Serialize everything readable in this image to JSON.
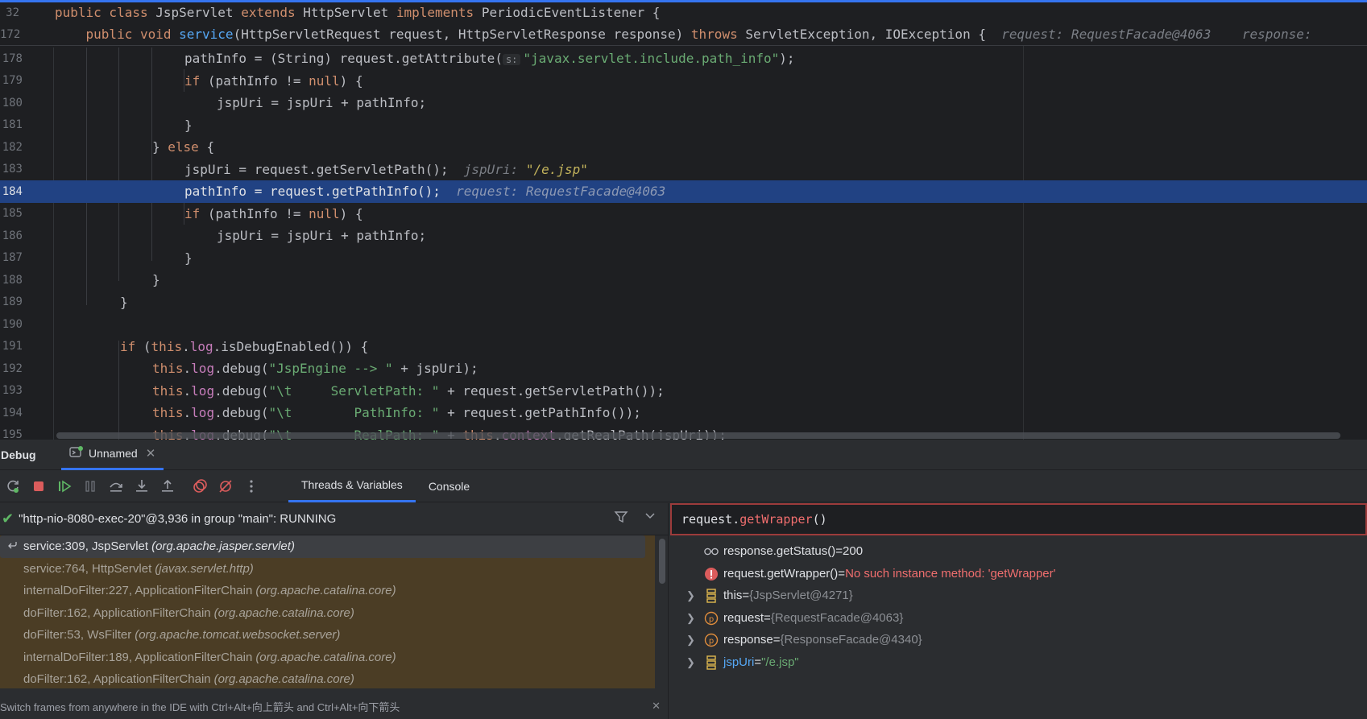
{
  "editor": {
    "sticky_lines": [
      {
        "num": "32",
        "code": "public class JspServlet extends HttpServlet implements PeriodicEventListener {"
      },
      {
        "num": "172",
        "code": "    public void service(HttpServletRequest request, HttpServletResponse response) throws ServletException, IOException {",
        "inlay": "request: RequestFacade@4063    response:"
      }
    ],
    "lines": [
      {
        "num": "178",
        "code": "pathInfo = (String) request.getAttribute(",
        "hint": "s:",
        "code2": "\"javax.servlet.include.path_info\");"
      },
      {
        "num": "179",
        "code": "if (pathInfo != null) {"
      },
      {
        "num": "180",
        "code": "jspUri = jspUri + pathInfo;"
      },
      {
        "num": "181",
        "code": "}"
      },
      {
        "num": "182",
        "code": "} else {"
      },
      {
        "num": "183",
        "code": "jspUri = request.getServletPath();",
        "inlay_label": "jspUri:",
        "inlay_value": "\"/e.jsp\""
      },
      {
        "num": "184",
        "code": "pathInfo = request.getPathInfo();",
        "inlay_label": "request: RequestFacade@4063"
      },
      {
        "num": "185",
        "code": "if (pathInfo != null) {"
      },
      {
        "num": "186",
        "code": "jspUri = jspUri + pathInfo;"
      },
      {
        "num": "187",
        "code": "}"
      },
      {
        "num": "188",
        "code": "}"
      },
      {
        "num": "189",
        "code": "}"
      },
      {
        "num": "190",
        "code": ""
      },
      {
        "num": "191",
        "code": "if (this.log.isDebugEnabled()) {"
      },
      {
        "num": "192",
        "code": "this.log.debug(\"JspEngine --> \" + jspUri);"
      },
      {
        "num": "193",
        "code": "this.log.debug(\"\\t     ServletPath: \" + request.getServletPath());"
      },
      {
        "num": "194",
        "code": "this.log.debug(\"\\t        PathInfo: \" + request.getPathInfo());"
      },
      {
        "num": "195",
        "code": "this.log.debug(\"\\t        RealPath: \" + this.context.getRealPath(jspUri));"
      }
    ]
  },
  "debug": {
    "title": "Debug",
    "session_tab": "Unnamed",
    "tabs": [
      "Threads & Variables",
      "Console"
    ],
    "thread": "\"http-nio-8080-exec-20\"@3,936 in group \"main\": RUNNING",
    "frames": [
      {
        "method": "service:309, JspServlet",
        "pkg": "(org.apache.jasper.servlet)"
      },
      {
        "method": "service:764, HttpServlet",
        "pkg": "(javax.servlet.http)"
      },
      {
        "method": "internalDoFilter:227, ApplicationFilterChain",
        "pkg": "(org.apache.catalina.core)"
      },
      {
        "method": "doFilter:162, ApplicationFilterChain",
        "pkg": "(org.apache.catalina.core)"
      },
      {
        "method": "doFilter:53, WsFilter",
        "pkg": "(org.apache.tomcat.websocket.server)"
      },
      {
        "method": "internalDoFilter:189, ApplicationFilterChain",
        "pkg": "(org.apache.catalina.core)"
      },
      {
        "method": "doFilter:162, ApplicationFilterChain",
        "pkg": "(org.apache.catalina.core)"
      }
    ],
    "tip": "Switch frames from anywhere in the IDE with Ctrl+Alt+向上箭头 and Ctrl+Alt+向下箭头",
    "eval_expression_obj": "request.",
    "eval_expression_method": "getWrapper",
    "eval_expression_tail": "()",
    "variables": [
      {
        "name": "response.getStatus()",
        "eq": " = ",
        "value": "200",
        "kind": "watch"
      },
      {
        "name": "request.getWrapper()",
        "eq": " = ",
        "value": "No such instance method: 'getWrapper'",
        "kind": "error"
      },
      {
        "name": "this",
        "eq": " = ",
        "value": "{JspServlet@4271}",
        "kind": "field"
      },
      {
        "name": "request",
        "eq": " = ",
        "value": "{RequestFacade@4063}",
        "kind": "param"
      },
      {
        "name": "response",
        "eq": " = ",
        "value": "{ResponseFacade@4340}",
        "kind": "param"
      },
      {
        "name": "jspUri",
        "eq": " = ",
        "value": "\"/e.jsp\"",
        "kind": "local"
      }
    ]
  },
  "colors": {
    "accent": "#3574f0",
    "current_line": "#214283",
    "frames_bg": "#4b3d25",
    "error": "#f06e6e",
    "string": "#6aab73",
    "keyword": "#cf8e6d"
  }
}
